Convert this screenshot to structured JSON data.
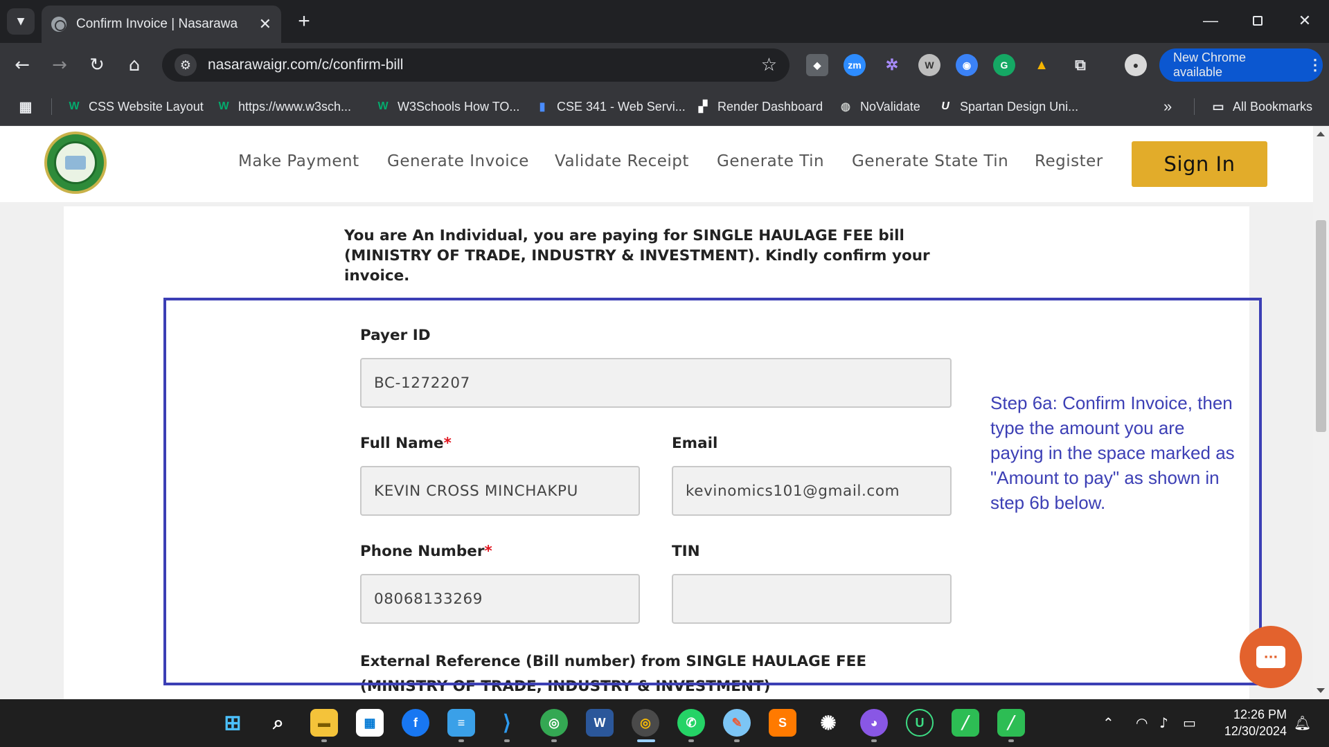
{
  "browser": {
    "tab_title": "Confirm Invoice | Nasarawa",
    "tab_close": "✕",
    "new_tab": "+",
    "url": "nasarawaigr.com/c/confirm-bill",
    "update_button": "New Chrome available",
    "bookmarks": [
      {
        "label": "CSS Website Layout",
        "icon": "w3schools-icon"
      },
      {
        "label": "https://www.w3sch...",
        "icon": "w3schools-icon"
      },
      {
        "label": "W3Schools How TO...",
        "icon": "w3schools-icon"
      },
      {
        "label": "CSE 341 - Web Servi...",
        "icon": "bar-chart-icon"
      },
      {
        "label": "Render Dashboard",
        "icon": "render-icon"
      },
      {
        "label": "NoValidate",
        "icon": "globe-icon"
      },
      {
        "label": "Spartan Design Uni...",
        "icon": "spartan-icon"
      }
    ],
    "all_bookmarks": "All Bookmarks",
    "overflow": "»"
  },
  "site": {
    "nav": [
      "Make Payment",
      "Generate Invoice",
      "Validate Receipt",
      "Generate Tin",
      "Generate State Tin",
      "Register"
    ],
    "sign_in": "Sign In"
  },
  "invoice": {
    "intro": "You are An Individual, you are paying for SINGLE HAULAGE FEE bill (MINISTRY OF TRADE, INDUSTRY & INVESTMENT). Kindly confirm your invoice.",
    "payer_id_label": "Payer ID",
    "payer_id_value": "BC-1272207",
    "full_name_label": "Full Name",
    "full_name_value": "KEVIN CROSS MINCHAKPU",
    "email_label": "Email",
    "email_value": "kevinomics101@gmail.com",
    "phone_label": "Phone Number",
    "phone_value": "08068133269",
    "tin_label": "TIN",
    "tin_value": "",
    "required_mark": "*",
    "external_ref_label": "External Reference (Bill number) from SINGLE HAULAGE FEE (MINISTRY OF TRADE, INDUSTRY & INVESTMENT)"
  },
  "annotation": {
    "text": "Step 6a: Confirm Invoice, then type the amount you are paying in the space marked as \"Amount to pay\" as shown in step 6b below."
  },
  "taskbar": {
    "time": "12:26 PM",
    "date": "12/30/2024"
  },
  "colors": {
    "accent_annotation": "#3c3fb5",
    "sign_in_button": "#e2ac2a",
    "chat_button": "#e3622d",
    "required": "#e0141e"
  }
}
